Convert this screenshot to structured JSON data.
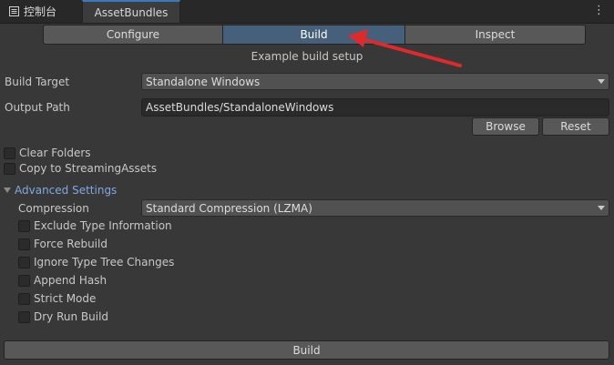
{
  "tabs": {
    "console_label": "控制台",
    "assetbundles_label": "AssetBundles",
    "menu_glyph": "⋮"
  },
  "segments": {
    "configure": "Configure",
    "build": "Build",
    "inspect": "Inspect",
    "active": "build"
  },
  "subtitle": "Example build setup",
  "form": {
    "build_target_label": "Build Target",
    "build_target_value": "Standalone Windows",
    "output_path_label": "Output Path",
    "output_path_value": "AssetBundles/StandaloneWindows",
    "browse_label": "Browse",
    "reset_label": "Reset"
  },
  "options": {
    "clear_folders": "Clear Folders",
    "copy_to_streaming": "Copy to StreamingAssets"
  },
  "advanced": {
    "title": "Advanced Settings",
    "compression_label": "Compression",
    "compression_value": "Standard Compression (LZMA)",
    "exclude_type_info": "Exclude Type Information",
    "force_rebuild": "Force Rebuild",
    "ignore_type_tree": "Ignore Type Tree Changes",
    "append_hash": "Append Hash",
    "strict_mode": "Strict Mode",
    "dry_run_build": "Dry Run Build"
  },
  "build_button": "Build",
  "colors": {
    "accent": "#3a79bb",
    "active_segment": "#46607c",
    "annotation_arrow": "#e02a2a",
    "foldout_text": "#7fa9e0"
  }
}
